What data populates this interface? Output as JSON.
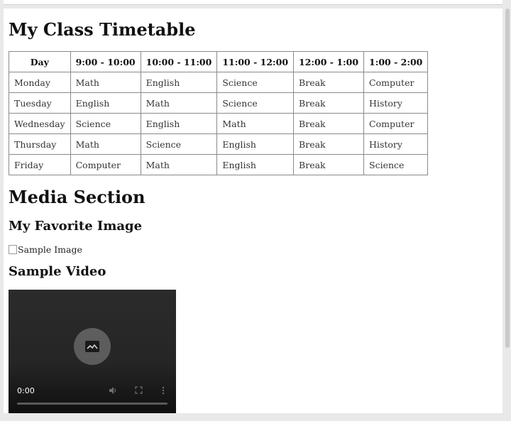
{
  "page": {
    "title": "My Class Timetable",
    "media_heading": "Media Section",
    "image_heading": "My Favorite Image",
    "image_alt": "Sample Image",
    "video_heading": "Sample Video"
  },
  "timetable": {
    "headers": [
      "Day",
      "9:00 - 10:00",
      "10:00 - 11:00",
      "11:00 - 12:00",
      "12:00 - 1:00",
      "1:00 - 2:00"
    ],
    "rows": [
      [
        "Monday",
        "Math",
        "English",
        "Science",
        "Break",
        "Computer"
      ],
      [
        "Tuesday",
        "English",
        "Math",
        "Science",
        "Break",
        "History"
      ],
      [
        "Wednesday",
        "Science",
        "English",
        "Math",
        "Break",
        "Computer"
      ],
      [
        "Thursday",
        "Math",
        "Science",
        "English",
        "Break",
        "History"
      ],
      [
        "Friday",
        "Computer",
        "Math",
        "English",
        "Break",
        "Science"
      ]
    ]
  },
  "video": {
    "time": "0:00",
    "progress": 0,
    "icons": [
      "image-placeholder-icon",
      "volume-icon",
      "fullscreen-icon",
      "more-options-icon"
    ]
  }
}
